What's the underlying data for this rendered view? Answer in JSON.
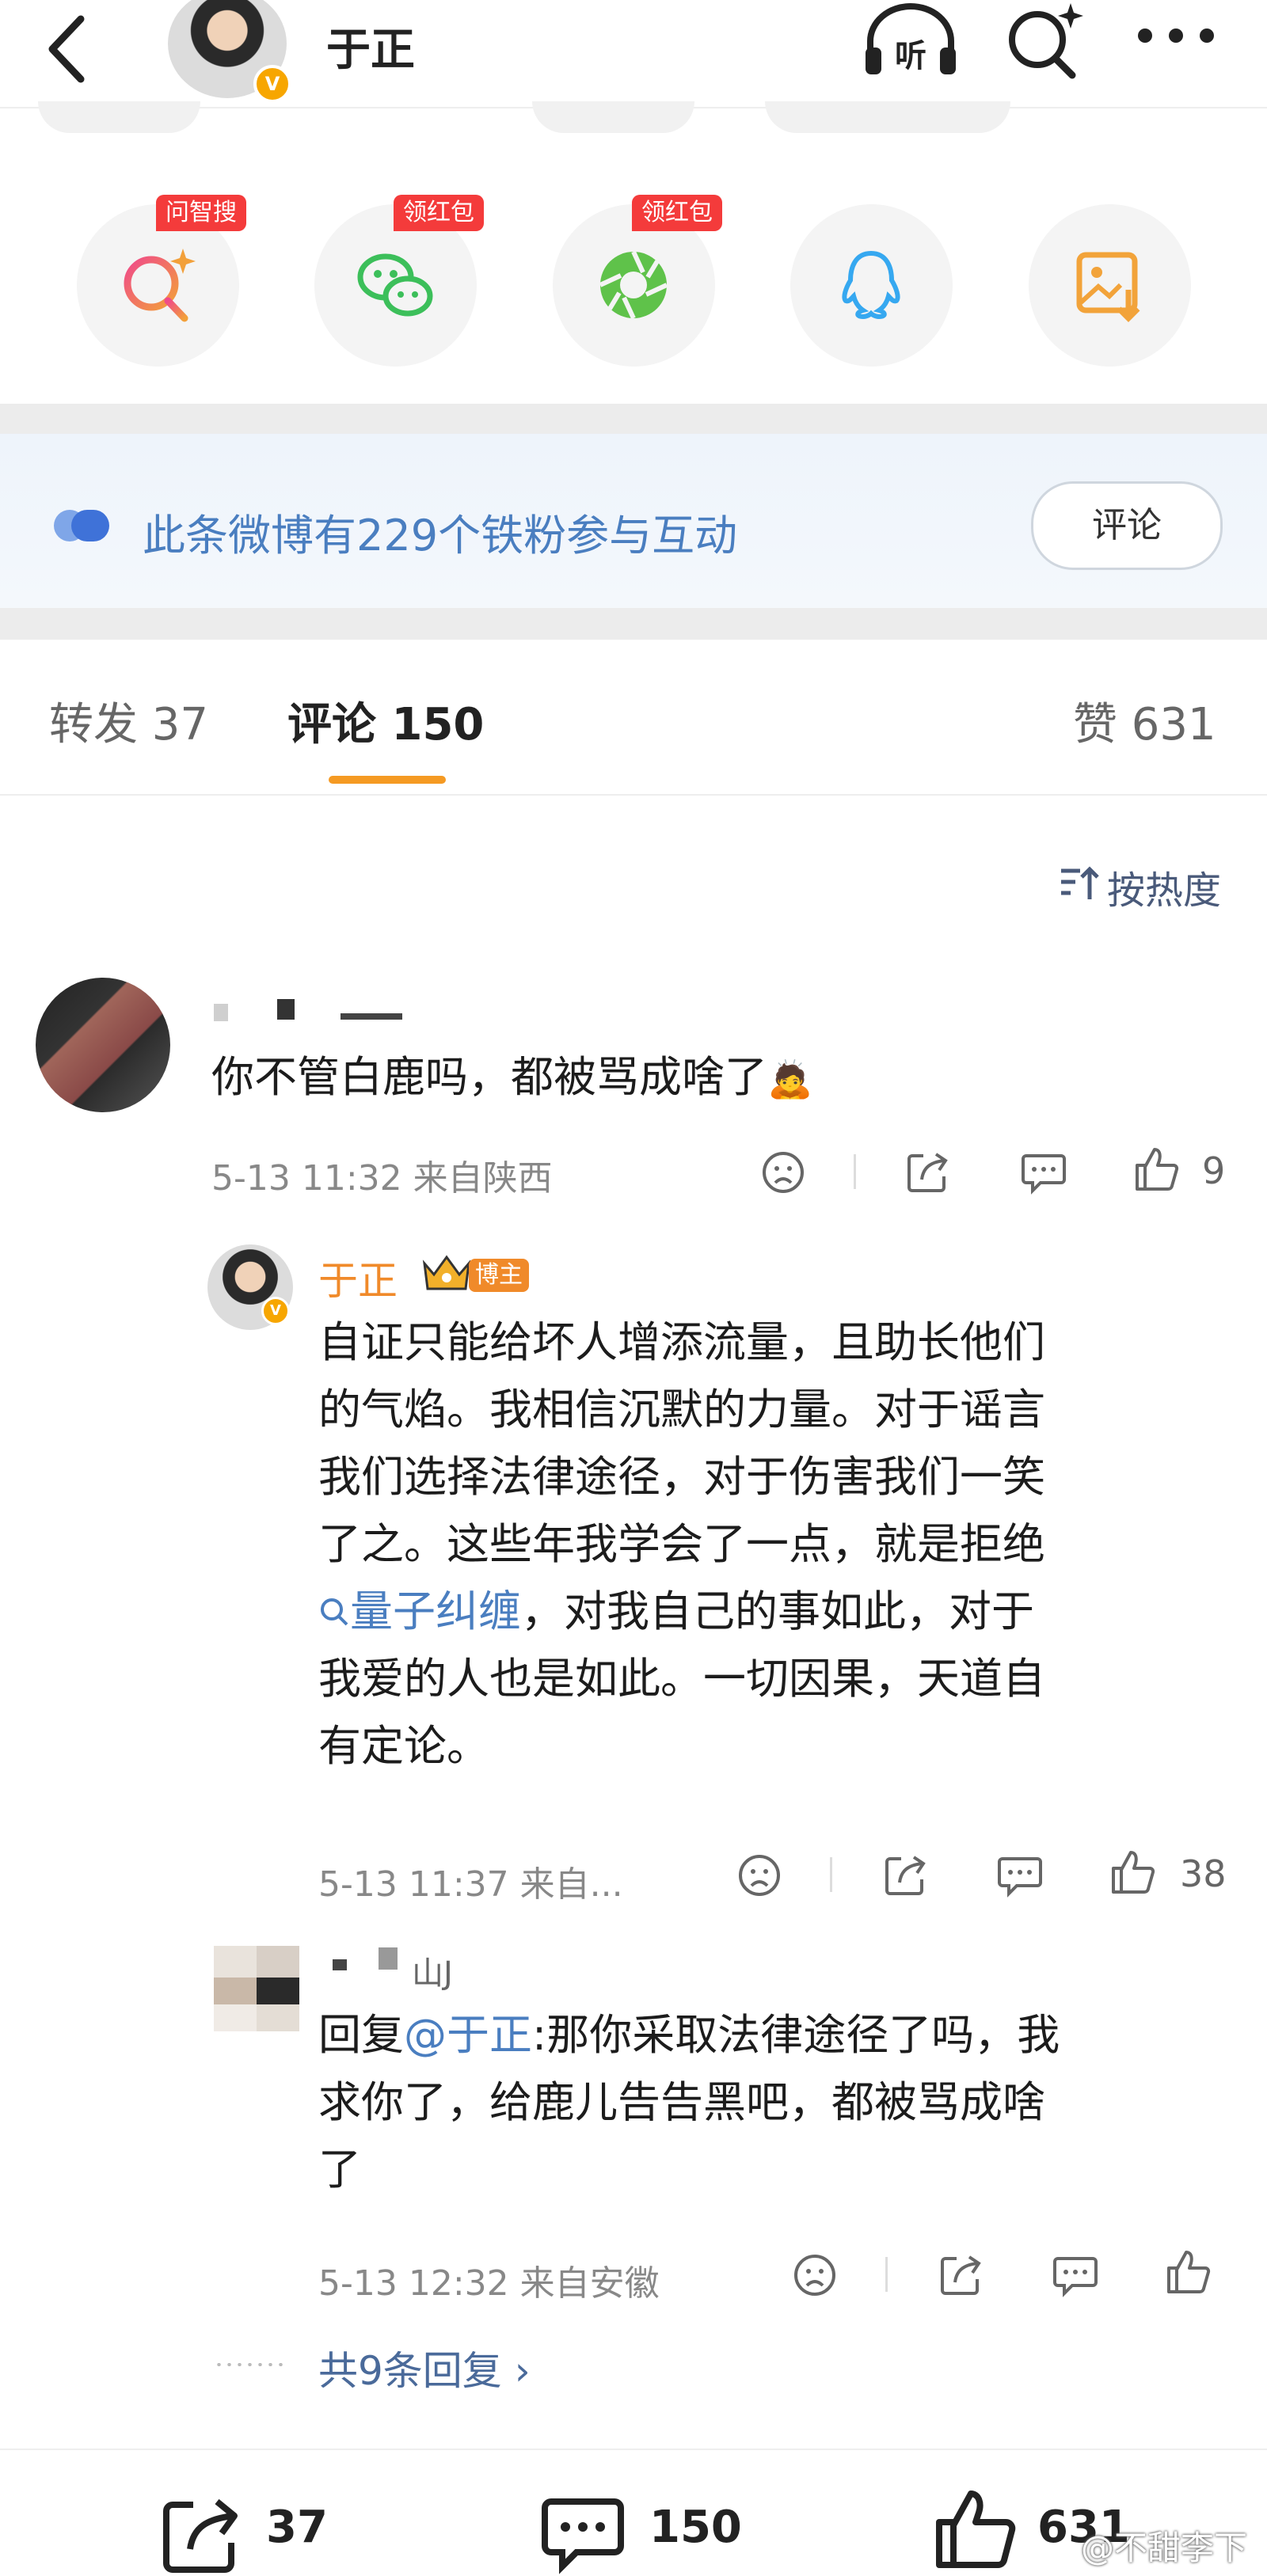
{
  "header": {
    "title": "于正",
    "verified_badge": "V",
    "listen_label": "听"
  },
  "share_bar": {
    "items": [
      {
        "icon": "search-ai-icon",
        "tag": "问智搜"
      },
      {
        "icon": "wechat-icon",
        "tag": "领红包"
      },
      {
        "icon": "moments-icon",
        "tag": "领红包"
      },
      {
        "icon": "qq-icon",
        "tag": ""
      },
      {
        "icon": "save-image-icon",
        "tag": ""
      }
    ]
  },
  "fans_banner": {
    "text": "此条微博有229个铁粉参与互动",
    "button": "评论"
  },
  "tabs": {
    "repost": "转发 37",
    "comment": "评论 150",
    "like": "赞 631"
  },
  "sort_label": "按热度",
  "comments": [
    {
      "text": "你不管白鹿吗，都被骂成啥了",
      "emoji": "🙇",
      "meta": "5-13 11:32 来自陕西",
      "like_count": "9",
      "reply": {
        "author": "于正",
        "badge": "博主",
        "lines": [
          "自证只能给坏人增添流量，且助长他们",
          "的气焰。我相信沉默的力量。对于谣言",
          "我们选择法律途径，对于伤害我们一笑",
          "了之。这些年我学会了一点，就是拒绝"
        ],
        "link_text": "量子纠缠",
        "line_after_link": "，对我自己的事如此，对于",
        "lines_end": [
          "我爱的人也是如此。一切因果，天道自",
          "有定论。"
        ],
        "meta": "5-13 11:37 来自...",
        "like_count": "38"
      },
      "reply2": {
        "name_partial": "山J",
        "prefix": "回复",
        "mention": "@于正",
        "lines": [
          ":那你采取法律途径了吗，我",
          "求你了，给鹿儿告告黑吧，都被骂成啥",
          "了"
        ],
        "meta": "5-13 12:32 来自安徽",
        "like_count": ""
      },
      "replies_more": "共9条回复 ›"
    }
  ],
  "bottom_bar": {
    "repost_count": "37",
    "comment_count": "150",
    "like_count": "631"
  },
  "watermark": "@不甜李下",
  "colors": {
    "accent_orange": "#f59a23",
    "link_blue": "#4a7ec0",
    "red_tag": "#f43b3b"
  }
}
